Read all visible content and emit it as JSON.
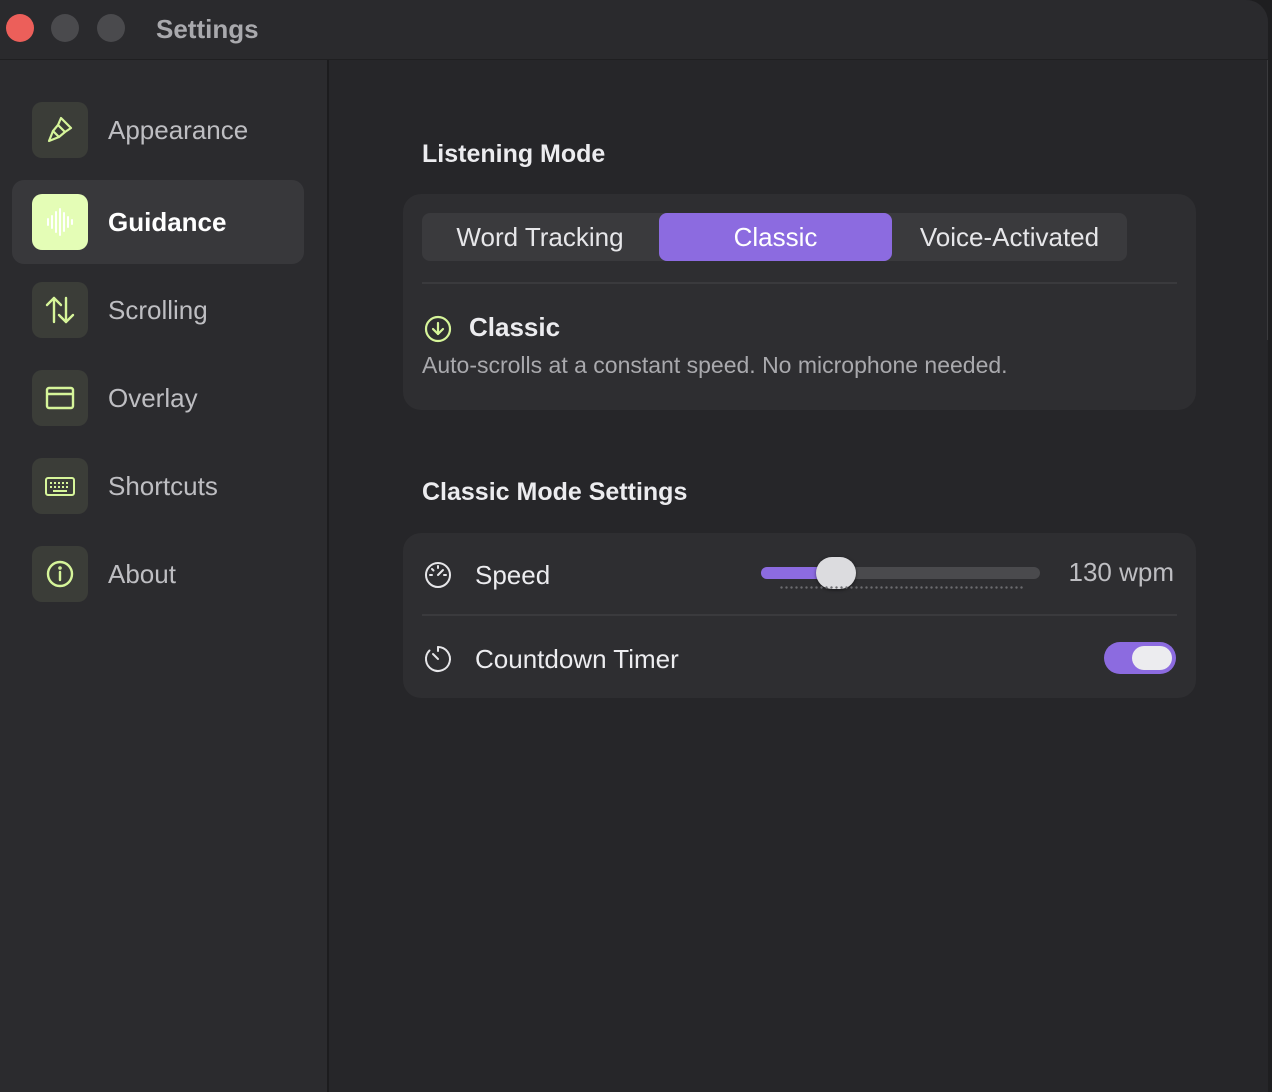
{
  "window": {
    "title": "Settings"
  },
  "sidebar": {
    "items": [
      {
        "label": "Appearance",
        "icon": "paintbrush-icon",
        "active": false
      },
      {
        "label": "Guidance",
        "icon": "waveform-icon",
        "active": true
      },
      {
        "label": "Scrolling",
        "icon": "arrows-up-down-icon",
        "active": false
      },
      {
        "label": "Overlay",
        "icon": "window-icon",
        "active": false
      },
      {
        "label": "Shortcuts",
        "icon": "keyboard-icon",
        "active": false
      },
      {
        "label": "About",
        "icon": "info-icon",
        "active": false
      }
    ]
  },
  "listening": {
    "title": "Listening Mode",
    "options": [
      "Word Tracking",
      "Classic",
      "Voice-Activated"
    ],
    "selected": "Classic",
    "info_title": "Classic",
    "info_desc": "Auto-scrolls at a constant speed. No microphone needed."
  },
  "classic_settings": {
    "title": "Classic Mode Settings",
    "speed_label": "Speed",
    "speed_value": "130 wpm",
    "speed_fraction": 0.27,
    "countdown_label": "Countdown Timer",
    "countdown_on": true
  },
  "colors": {
    "accent": "#8c6be0",
    "icon_green": "#d6f59a",
    "active_icon_bg": "#e4fdb6"
  }
}
